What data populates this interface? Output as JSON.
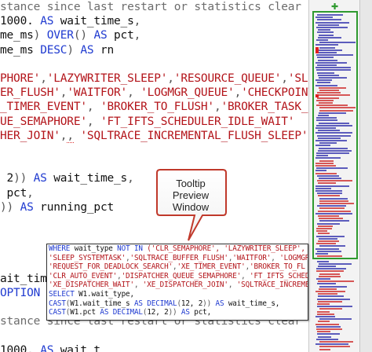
{
  "editor": {
    "lines": [
      {
        "segs": [
          [
            "g",
            "stance since last restart or statistics clear"
          ]
        ]
      },
      {
        "segs": [
          [
            "n",
            "1000. "
          ],
          [
            "k",
            "AS"
          ],
          [
            "n",
            " wait_time_s"
          ],
          [
            "p",
            ","
          ]
        ]
      },
      {
        "segs": [
          [
            "n",
            "me_ms"
          ],
          [
            "p",
            ") "
          ],
          [
            "k",
            "OVER"
          ],
          [
            "p",
            "() "
          ],
          [
            "k",
            "AS"
          ],
          [
            "n",
            " pct"
          ],
          [
            "p",
            ","
          ]
        ]
      },
      {
        "segs": [
          [
            "n",
            "me_ms "
          ],
          [
            "k",
            "DESC"
          ],
          [
            "p",
            ") "
          ],
          [
            "k",
            "AS"
          ],
          [
            "n",
            " rn"
          ]
        ]
      },
      {
        "segs": [
          [
            "n",
            ""
          ]
        ]
      },
      {
        "segs": [
          [
            "s",
            "PHORE'"
          ],
          [
            "p",
            ","
          ],
          [
            "s",
            "'LAZYWRITER_SLEEP'"
          ],
          [
            "p",
            ","
          ],
          [
            "s",
            "'RESOURCE_QUEUE'"
          ],
          [
            "p",
            ","
          ],
          [
            "s",
            "'SLEEP"
          ]
        ]
      },
      {
        "segs": [
          [
            "s",
            "ER_FLUSH'"
          ],
          [
            "p",
            ","
          ],
          [
            "s",
            "'WAITFOR'"
          ],
          [
            "p",
            ","
          ],
          [
            "s",
            " 'LOGMGR_QUEUE'"
          ],
          [
            "p",
            ","
          ],
          [
            "s",
            "'CHECKPOINT_"
          ]
        ]
      },
      {
        "segs": [
          [
            "s",
            "_TIMER_EVENT'"
          ],
          [
            "p",
            ","
          ],
          [
            "s",
            " 'BROKER_TO_FLUSH'"
          ],
          [
            "p",
            ","
          ],
          [
            "s",
            "'BROKER_TASK_STO"
          ]
        ]
      },
      {
        "segs": [
          [
            "s",
            "UE_SEMAPHORE'"
          ],
          [
            "p",
            ","
          ],
          [
            "s",
            " 'FT_IFTS_SCHEDULER_IDLE_WAIT'"
          ]
        ]
      },
      {
        "segs": [
          [
            "s",
            "HER_JOIN'"
          ],
          [
            "p",
            ","
          ],
          [
            "sq",
            ","
          ],
          [
            "s",
            " 'SQLTRACE_INCREMENTAL_FLUSH_SLEEP'"
          ],
          [
            "p",
            "))"
          ]
        ]
      },
      {
        "segs": [
          [
            "n",
            ""
          ]
        ]
      },
      {
        "segs": [
          [
            "n",
            ""
          ]
        ]
      },
      {
        "segs": [
          [
            "n",
            " 2"
          ],
          [
            "p",
            "))"
          ],
          [
            "k",
            " AS"
          ],
          [
            "n",
            " wait_time_s"
          ],
          [
            "p",
            ","
          ]
        ]
      },
      {
        "segs": [
          [
            "n",
            " pct"
          ],
          [
            "p",
            ","
          ]
        ]
      },
      {
        "segs": [
          [
            "p",
            ")) "
          ],
          [
            "k",
            "AS"
          ],
          [
            "n",
            " running_pct"
          ]
        ]
      },
      {
        "segs": [
          [
            "n",
            ""
          ]
        ]
      },
      {
        "segs": [
          [
            "n",
            ""
          ]
        ]
      },
      {
        "segs": [
          [
            "n",
            ""
          ]
        ]
      },
      {
        "segs": [
          [
            "n",
            ""
          ]
        ]
      },
      {
        "segs": [
          [
            "n",
            "ait_tim"
          ]
        ]
      },
      {
        "segs": [
          [
            "k",
            "OPTION"
          ],
          [
            "n",
            " ("
          ]
        ]
      },
      {
        "segs": [
          [
            "n",
            ""
          ]
        ]
      },
      {
        "segs": [
          [
            "g",
            "stance since last restart or statistics clear"
          ]
        ]
      },
      {
        "segs": [
          [
            "n",
            ""
          ]
        ]
      },
      {
        "segs": [
          [
            "n",
            "1000. "
          ],
          [
            "k",
            "AS"
          ],
          [
            "n",
            " wait_t"
          ]
        ]
      }
    ]
  },
  "tooltip": {
    "lines": [
      {
        "segs": [
          [
            "k",
            "WHERE"
          ],
          [
            "n",
            " wait_type "
          ],
          [
            "k",
            "NOT IN"
          ],
          [
            "s",
            " ('CLR_SEMAPHORE', 'LAZYWRITER_SLEEP', 'RE"
          ]
        ]
      },
      {
        "segs": [
          [
            "s",
            "'SLEEP_SYSTEMTASK'"
          ],
          [
            "p",
            ","
          ],
          [
            "s",
            "'SQLTRACE_BUFFER_FLUSH'"
          ],
          [
            "p",
            ","
          ],
          [
            "s",
            "'WAITFOR'"
          ],
          [
            "p",
            ","
          ],
          [
            "s",
            " 'LOGMGR_"
          ]
        ]
      },
      {
        "segs": [
          [
            "s",
            "'REQUEST_FOR_DEADLOCK_SEARCH'"
          ],
          [
            "p",
            ","
          ],
          [
            "s",
            "'XE_TIMER_EVENT'"
          ],
          [
            "p",
            ","
          ],
          [
            "s",
            "'BROKER_TO_FL"
          ]
        ]
      },
      {
        "segs": [
          [
            "s",
            "'CLR_AUTO_EVENT'"
          ],
          [
            "p",
            ","
          ],
          [
            "s",
            "'DISPATCHER_QUEUE_SEMAPHORE'"
          ],
          [
            "p",
            ","
          ],
          [
            "s",
            " 'FT_IFTS_SCHEDU"
          ]
        ]
      },
      {
        "segs": [
          [
            "s",
            "'XE_DISPATCHER_WAIT'"
          ],
          [
            "p",
            ","
          ],
          [
            "s",
            " 'XE_DISPATCHER_JOIN'"
          ],
          [
            "p",
            ","
          ],
          [
            "s",
            " 'SQLTRACE_INCREME"
          ]
        ]
      },
      {
        "segs": [
          [
            "k",
            "SELECT"
          ],
          [
            "n",
            " W1.wait_type,"
          ]
        ]
      },
      {
        "segs": [
          [
            "k",
            "CAST"
          ],
          [
            "p",
            "("
          ],
          [
            "n",
            "W1.wait_time_s "
          ],
          [
            "k",
            "AS DECIMAL"
          ],
          [
            "p",
            "("
          ],
          [
            "n",
            "12, 2"
          ],
          [
            "p",
            "))"
          ],
          [
            "k",
            " AS"
          ],
          [
            "n",
            " wait_time_s,"
          ]
        ]
      },
      {
        "segs": [
          [
            "k",
            "CAST"
          ],
          [
            "p",
            "("
          ],
          [
            "n",
            "W1.pct "
          ],
          [
            "k",
            "AS DECIMAL"
          ],
          [
            "p",
            "("
          ],
          [
            "n",
            "12, 2"
          ],
          [
            "p",
            "))"
          ],
          [
            "k",
            " AS"
          ],
          [
            "n",
            " pct,"
          ]
        ]
      }
    ]
  },
  "callout": {
    "title": "Tooltip",
    "line2": "Preview",
    "line3": "Window"
  },
  "overview": {
    "colors": {
      "code": "#2a2aaa",
      "string": "#cc2222",
      "green": "#2f9a2f",
      "marker": "#d4a017"
    }
  }
}
